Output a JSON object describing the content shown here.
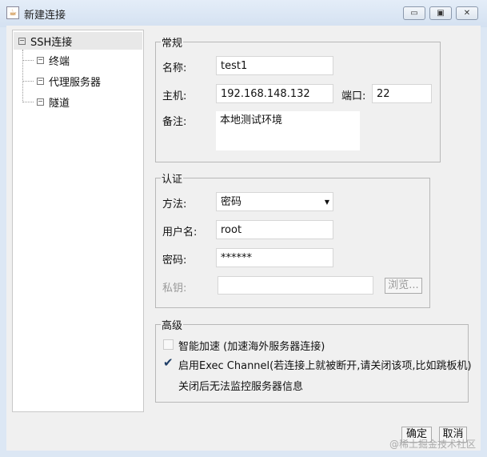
{
  "window": {
    "title": "新建连接",
    "icon": "java-icon",
    "controls": {
      "minimize": "▭",
      "maximize": "▣",
      "close": "✕"
    }
  },
  "tree": {
    "root": "SSH连接",
    "children": [
      "终端",
      "代理服务器",
      "隧道"
    ]
  },
  "general": {
    "legend": "常规",
    "name_label": "名称:",
    "name_value": "test1",
    "host_label": "主机:",
    "host_value": "192.168.148.132",
    "port_label": "端口:",
    "port_value": "22",
    "note_label": "备注:",
    "note_value": "本地测试环境"
  },
  "auth": {
    "legend": "认证",
    "method_label": "方法:",
    "method_value": "密码",
    "user_label": "用户名:",
    "user_value": "root",
    "password_label": "密码:",
    "password_value": "******",
    "key_label": "私钥:",
    "key_value": "",
    "browse_label": "浏览..."
  },
  "advanced": {
    "legend": "高级",
    "smart_accel_label": "智能加速 (加速海外服务器连接)",
    "smart_accel_checked": false,
    "exec_channel_label": "启用Exec Channel(若连接上就被断开,请关闭该项,比如跳板机)",
    "exec_channel_checked": true,
    "exec_channel_note": "关闭后无法监控服务器信息"
  },
  "footer": {
    "ok_label": "确定",
    "cancel_label": "取消",
    "watermark": "@稀土掘金技术社区"
  }
}
